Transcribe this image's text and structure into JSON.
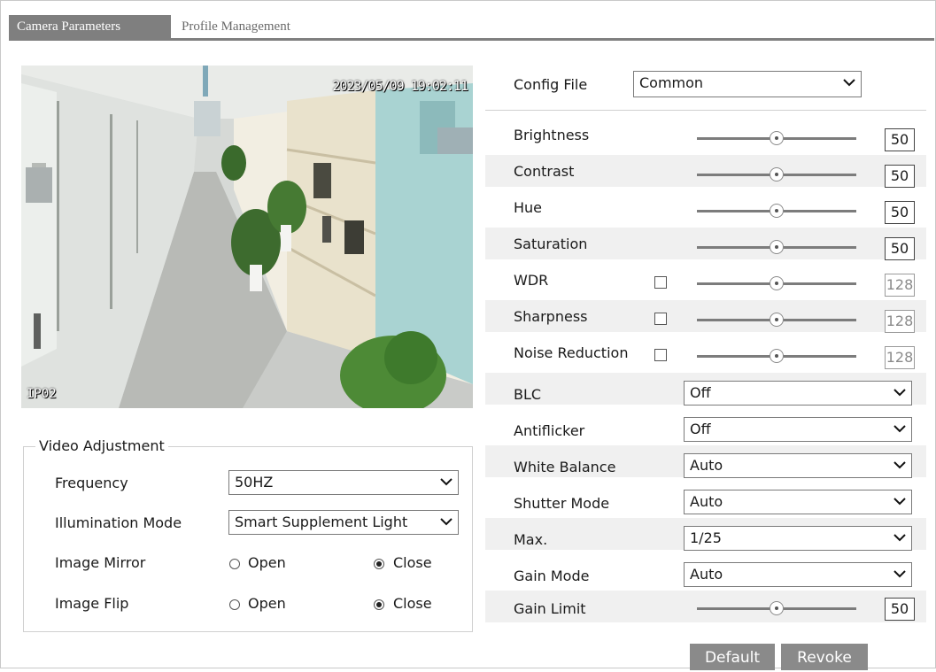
{
  "tabs": [
    {
      "label": "Camera Parameters",
      "active": true
    },
    {
      "label": "Profile Management",
      "active": false
    }
  ],
  "video": {
    "timestamp": "2023/05/09 19:02:11",
    "camera_name": "IP02"
  },
  "video_adjustment": {
    "title": "Video Adjustment",
    "frequency": {
      "label": "Frequency",
      "value": "50HZ"
    },
    "illumination": {
      "label": "Illumination Mode",
      "value": "Smart Supplement Light"
    },
    "mirror": {
      "label": "Image Mirror",
      "options": [
        "Open",
        "Close"
      ],
      "selected": "Close"
    },
    "flip": {
      "label": "Image Flip",
      "options": [
        "Open",
        "Close"
      ],
      "selected": "Close"
    }
  },
  "config_file": {
    "label": "Config File",
    "value": "Common"
  },
  "sliders": [
    {
      "label": "Brightness",
      "value": "50",
      "checkbox": false,
      "enabled": true
    },
    {
      "label": "Contrast",
      "value": "50",
      "checkbox": false,
      "enabled": true
    },
    {
      "label": "Hue",
      "value": "50",
      "checkbox": false,
      "enabled": true
    },
    {
      "label": "Saturation",
      "value": "50",
      "checkbox": false,
      "enabled": true
    },
    {
      "label": "WDR",
      "value": "128",
      "checkbox": true,
      "checked": false,
      "enabled": false
    },
    {
      "label": "Sharpness",
      "value": "128",
      "checkbox": true,
      "checked": false,
      "enabled": false
    },
    {
      "label": "Noise Reduction",
      "value": "128",
      "checkbox": true,
      "checked": false,
      "enabled": false
    }
  ],
  "dropdowns": [
    {
      "label": "BLC",
      "value": "Off"
    },
    {
      "label": "Antiflicker",
      "value": "Off"
    },
    {
      "label": "White Balance",
      "value": "Auto"
    },
    {
      "label": "Shutter Mode",
      "value": "Auto"
    },
    {
      "label": "Max.",
      "value": "1/25"
    },
    {
      "label": "Gain Mode",
      "value": "Auto"
    }
  ],
  "gain_limit": {
    "label": "Gain Limit",
    "value": "50"
  },
  "buttons": {
    "default": "Default",
    "revoke": "Revoke"
  },
  "colors": {
    "tab_active": "#7f7f7f",
    "button": "#8a8a8a",
    "row_stripe": "#f0f0f0"
  }
}
